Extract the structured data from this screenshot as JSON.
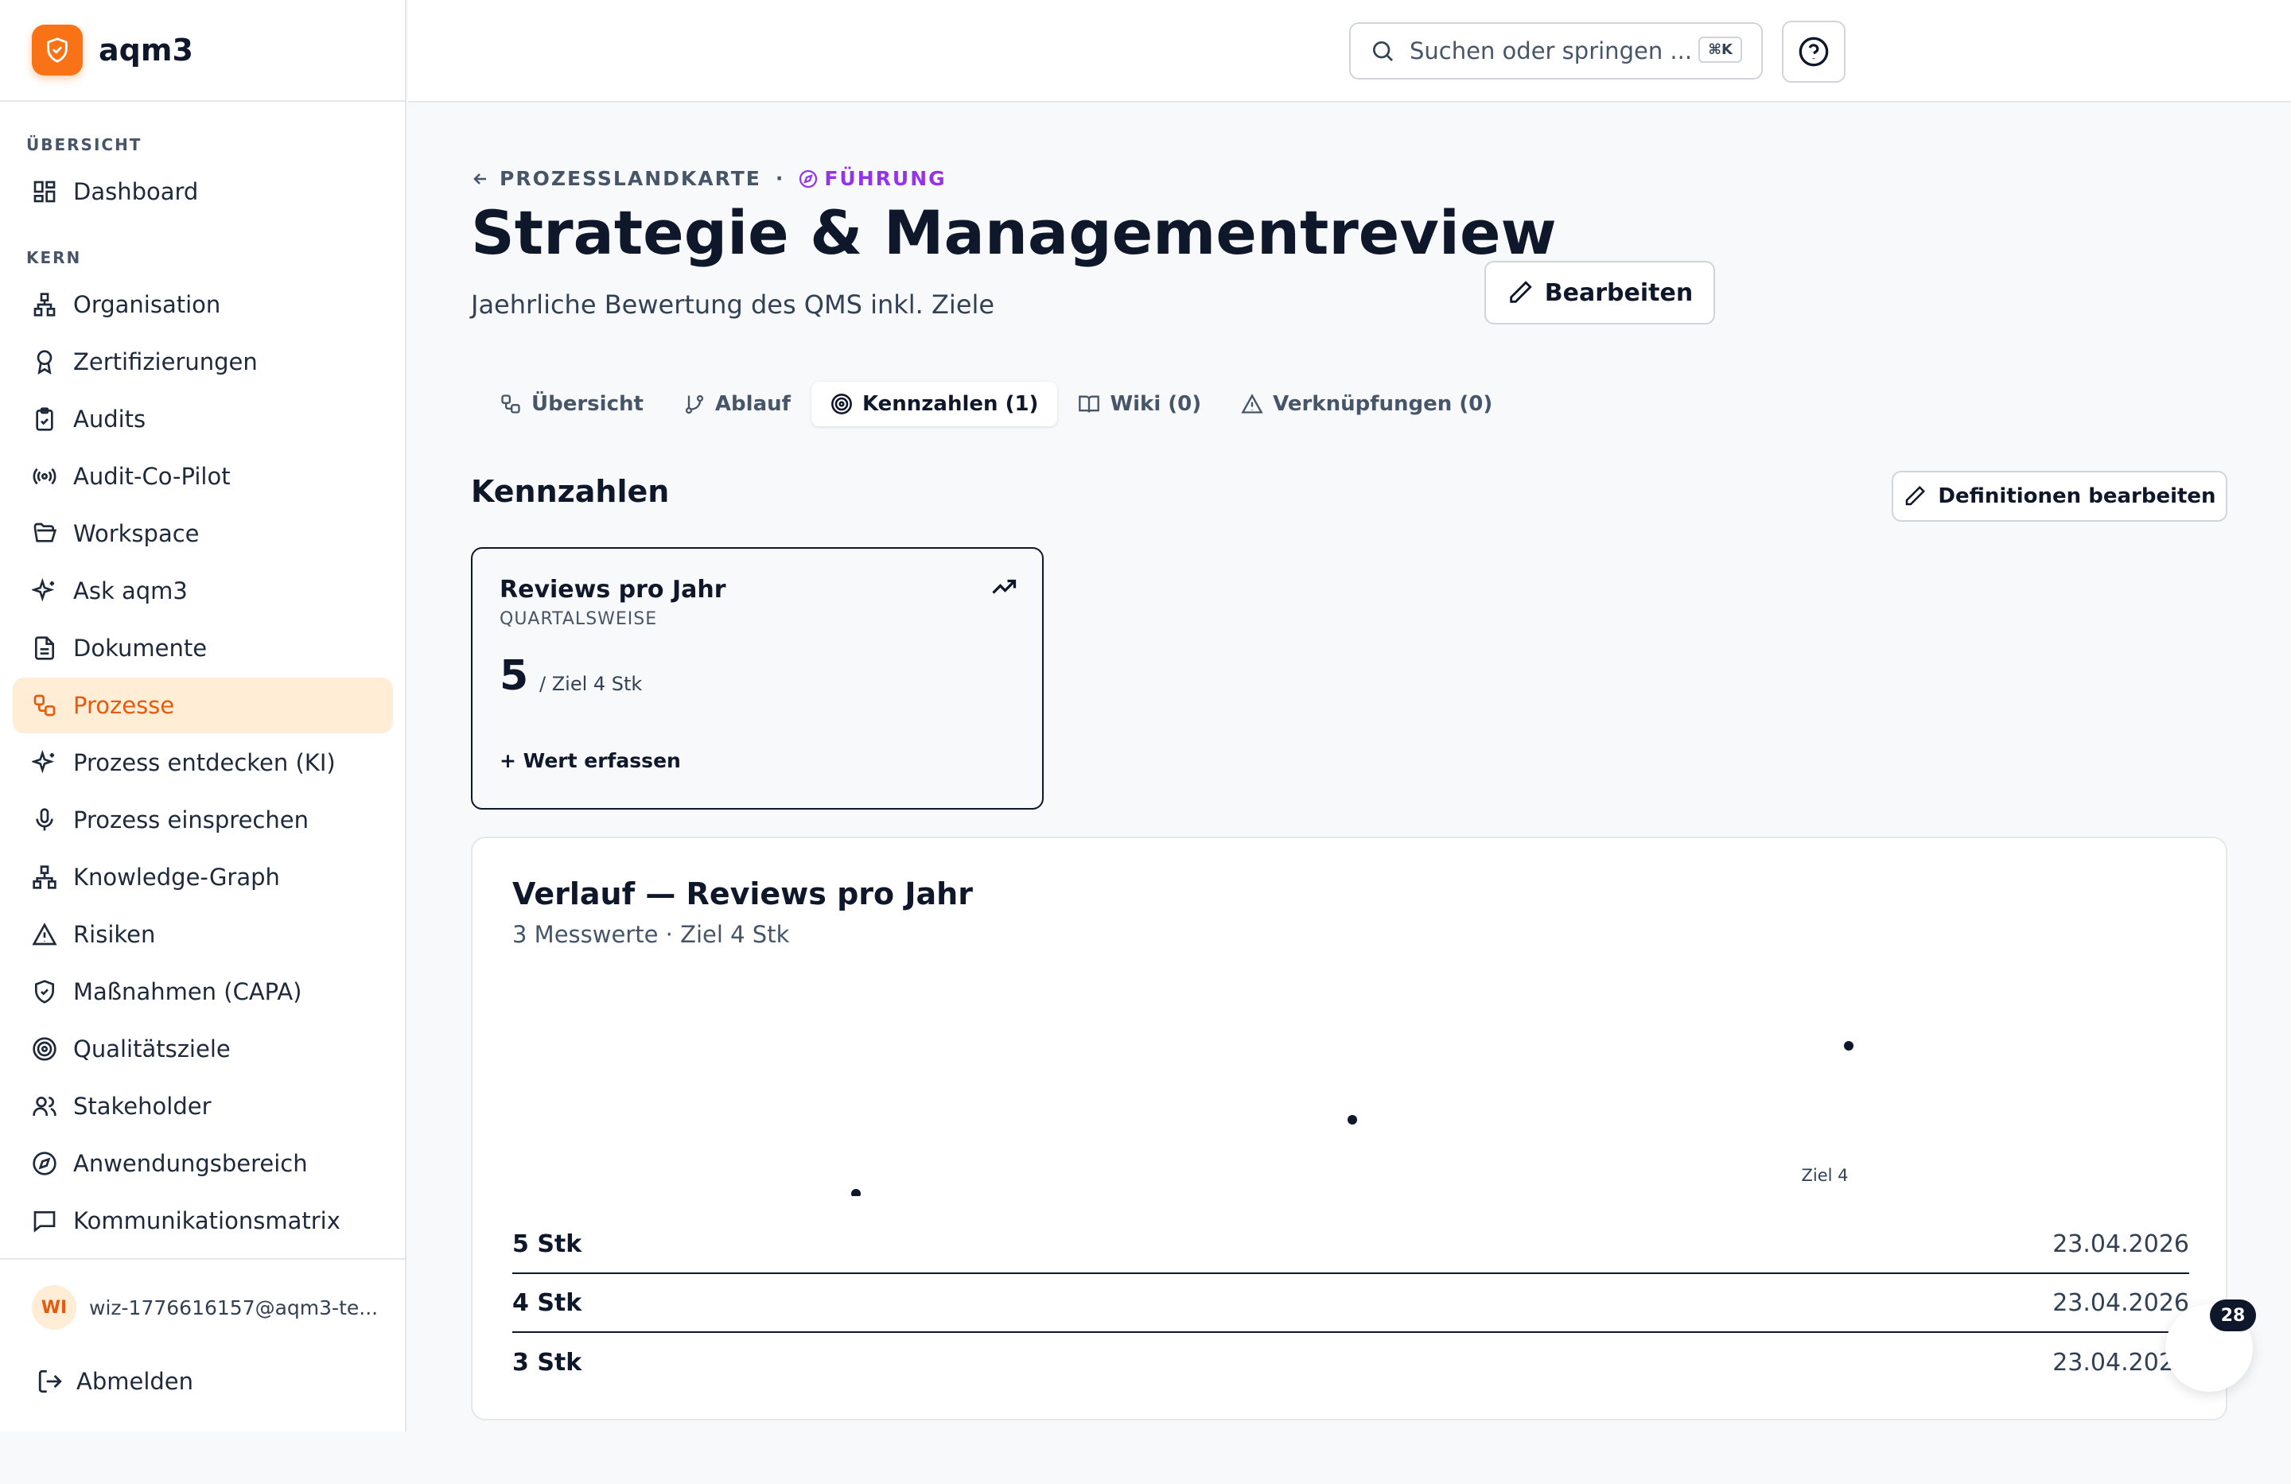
{
  "app": {
    "name": "aqm3"
  },
  "sidebar": {
    "sections": [
      {
        "label": "ÜBERSICHT",
        "items": [
          {
            "label": "Dashboard",
            "icon": "dashboard-icon"
          }
        ]
      },
      {
        "label": "KERN",
        "items": [
          {
            "label": "Organisation",
            "icon": "org-chart-icon"
          },
          {
            "label": "Zertifizierungen",
            "icon": "award-icon"
          },
          {
            "label": "Audits",
            "icon": "clipboard-check-icon"
          },
          {
            "label": "Audit-Co-Pilot",
            "icon": "radio-icon"
          },
          {
            "label": "Workspace",
            "icon": "folder-open-icon"
          },
          {
            "label": "Ask aqm3",
            "icon": "sparkles-icon"
          },
          {
            "label": "Dokumente",
            "icon": "file-text-icon"
          },
          {
            "label": "Prozesse",
            "icon": "workflow-icon",
            "active": true
          },
          {
            "label": "Prozess entdecken (KI)",
            "icon": "sparkles-icon"
          },
          {
            "label": "Prozess einsprechen",
            "icon": "microphone-icon"
          },
          {
            "label": "Knowledge-Graph",
            "icon": "network-icon"
          },
          {
            "label": "Risiken",
            "icon": "alert-triangle-icon"
          },
          {
            "label": "Maßnahmen (CAPA)",
            "icon": "shield-check-icon"
          },
          {
            "label": "Qualitätsziele",
            "icon": "target-icon"
          },
          {
            "label": "Stakeholder",
            "icon": "users-icon"
          },
          {
            "label": "Anwendungsbereich",
            "icon": "compass-icon"
          },
          {
            "label": "Kommunikationsmatrix",
            "icon": "message-square-icon"
          }
        ]
      }
    ],
    "user": {
      "initials": "WI",
      "email": "wiz-1776616157@aqm3-te..."
    },
    "logout_label": "Abmelden"
  },
  "topbar": {
    "search_placeholder": "Suchen oder springen ...",
    "shortcut": "⌘K"
  },
  "page": {
    "breadcrumb": {
      "parent": "PROZESSLANDKARTE",
      "separator": "·",
      "category": "FÜHRUNG"
    },
    "title": "Strategie & Managementreview",
    "subtitle": "Jaehrliche Bewertung des QMS inkl. Ziele",
    "edit_label": "Bearbeiten",
    "tabs": [
      {
        "label": "Übersicht",
        "icon": "workflow-icon"
      },
      {
        "label": "Ablauf",
        "icon": "git-branch-icon"
      },
      {
        "label": "Kennzahlen (1)",
        "icon": "target-icon",
        "active": true
      },
      {
        "label": "Wiki (0)",
        "icon": "book-open-icon"
      },
      {
        "label": "Verknüpfungen (0)",
        "icon": "alert-triangle-icon"
      }
    ],
    "section_title": "Kennzahlen",
    "definitions_label": "Definitionen bearbeiten"
  },
  "kpi": {
    "name": "Reviews pro Jahr",
    "frequency": "QUARTALSWEISE",
    "value": "5",
    "target_text": "/ Ziel 4 Stk",
    "add_label": "+ Wert erfassen"
  },
  "history": {
    "title": "Verlauf — Reviews pro Jahr",
    "subtitle": "3 Messwerte · Ziel 4 Stk",
    "target_label": "Ziel 4",
    "rows": [
      {
        "value": "5 Stk",
        "date": "23.04.2026"
      },
      {
        "value": "4 Stk",
        "date": "23.04.2026"
      },
      {
        "value": "3 Stk",
        "date": "23.04.2026"
      }
    ]
  },
  "chart_data": {
    "type": "scatter",
    "x": [
      1,
      2,
      3
    ],
    "y": [
      3,
      4,
      5
    ],
    "target": 4,
    "ylim": [
      3,
      5
    ],
    "title": "Verlauf — Reviews pro Jahr",
    "xlabel": "",
    "ylabel": ""
  },
  "fab": {
    "badge": "28"
  },
  "colors": {
    "accent": "#f97316",
    "active_bg": "#ffedd5",
    "category": "#9333ea",
    "text": "#0f172a"
  }
}
